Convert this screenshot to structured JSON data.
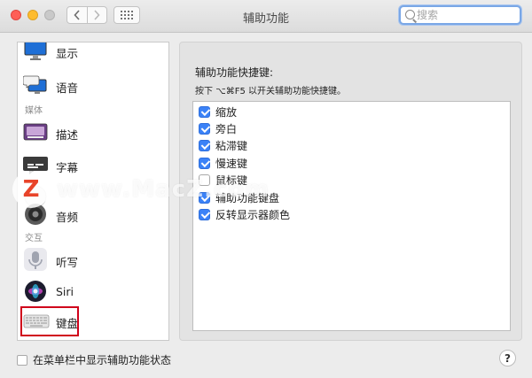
{
  "window": {
    "title": "辅助功能",
    "search_placeholder": "搜索"
  },
  "sidebar": {
    "items": [
      {
        "label": "显示",
        "icon": "display-icon"
      },
      {
        "label": "语音",
        "icon": "speech-icon"
      },
      {
        "label": "描述",
        "icon": "descriptions-icon"
      },
      {
        "label": "字幕",
        "icon": "captions-icon"
      },
      {
        "label": "缩放",
        "icon": "zoom-app-icon"
      },
      {
        "label": "音频",
        "icon": "audio-icon"
      },
      {
        "label": "听写",
        "icon": "microphone-icon"
      },
      {
        "label": "Siri",
        "icon": "siri-icon"
      },
      {
        "label": "键盘",
        "icon": "keyboard-icon"
      }
    ],
    "sections": {
      "media": "媒体",
      "interaction": "交互"
    },
    "selected": "键盘"
  },
  "panel": {
    "title": "辅助功能快捷键:",
    "description": "按下 ⌥⌘F5 以开关辅助功能快捷键。",
    "shortcuts": [
      {
        "label": "缩放",
        "checked": true
      },
      {
        "label": "旁白",
        "checked": true
      },
      {
        "label": "粘滞键",
        "checked": true
      },
      {
        "label": "慢速键",
        "checked": true
      },
      {
        "label": "鼠标键",
        "checked": false
      },
      {
        "label": "辅助功能键盘",
        "checked": true
      },
      {
        "label": "反转显示器颜色",
        "checked": true
      }
    ]
  },
  "footer": {
    "menubar_checkbox_label": "在菜单栏中显示辅助功能状态",
    "menubar_checked": false,
    "help_label": "?"
  },
  "watermark": {
    "logo_letter": "Z",
    "text": "www.MacZ.com"
  },
  "colors": {
    "accent": "#3b82f7",
    "selection_outline": "#d0021b"
  }
}
